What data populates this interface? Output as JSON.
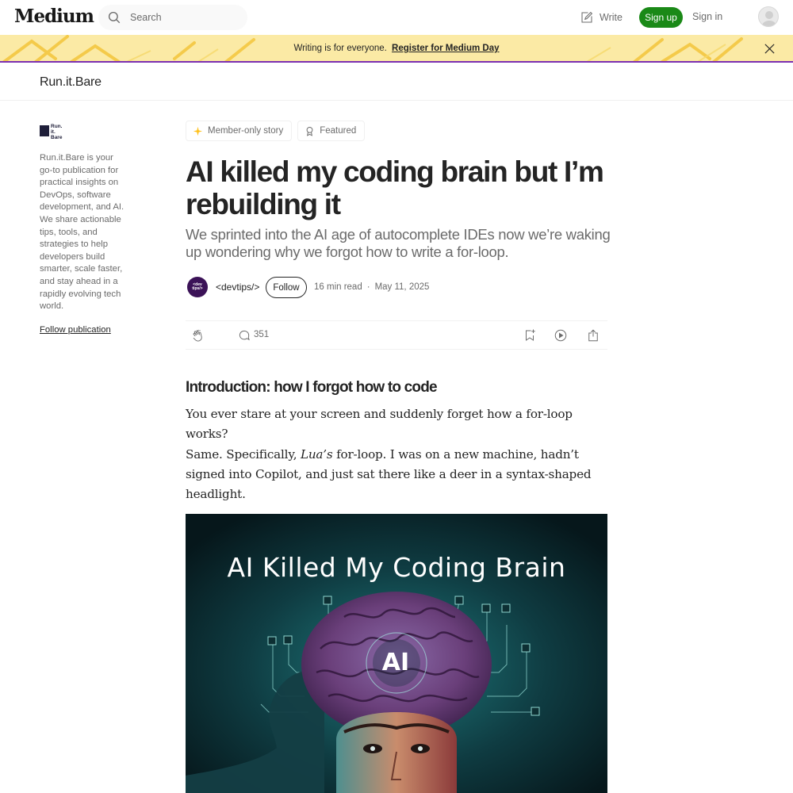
{
  "nav": {
    "logo": "Medium",
    "search_placeholder": "Search",
    "write_label": "Write",
    "signup_label": "Sign up",
    "signin_label": "Sign in"
  },
  "banner": {
    "text": "Writing is for everyone.",
    "link": "Register for Medium Day"
  },
  "publication": {
    "name": "Run.it.Bare",
    "logo_lines": [
      "Run.",
      "it.",
      "Bare"
    ],
    "description": "Run.it.Bare is your go-to publication for practical insights on DevOps, software development, and AI. We share actionable tips, tools, and strategies to help developers build smarter, scale faster, and stay ahead in a rapidly evolving tech world.",
    "follow_label": "Follow publication"
  },
  "article": {
    "badges": [
      {
        "label": "Member-only story",
        "icon": "sparkle-icon"
      },
      {
        "label": "Featured",
        "icon": "badge-icon"
      }
    ],
    "title": "AI killed my coding brain but I’m rebuilding it",
    "subtitle": "We sprinted into the AI age of autocomplete IDEs now we’re waking up wondering why we forgot how to write a for-loop.",
    "author": {
      "name": "<devtips/>",
      "avatar_text": "<dev tips/>",
      "follow_label": "Follow"
    },
    "read_time": "16 min read",
    "date": "May 11, 2025",
    "responses": "351",
    "section_heading": "Introduction: how I forgot how to code",
    "para1": "You ever stare at your screen and suddenly forget how a for-loop works?",
    "para2_before": "Same. Specifically, ",
    "para2_em": "Lua’s",
    "para2_after": " for-loop. I was on a new machine, hadn’t signed into Copilot, and just sat there like a deer in a syntax-shaped headlight.",
    "hero": {
      "title": "AI Killed My Coding Brain",
      "brain_label": "AI"
    }
  },
  "colors": {
    "brand_green": "#1a8917",
    "banner_bg": "#fbeaa5",
    "banner_border": "#7b2fb2"
  }
}
